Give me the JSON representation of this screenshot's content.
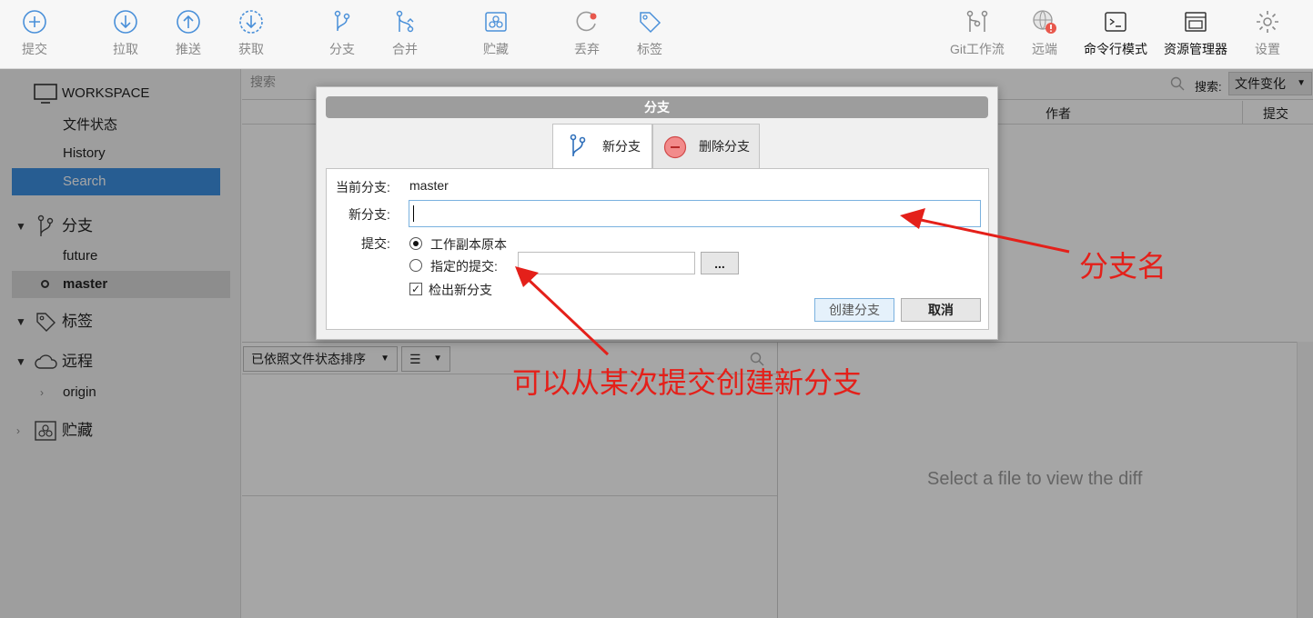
{
  "toolbar": {
    "commit": "提交",
    "pull": "拉取",
    "push": "推送",
    "fetch": "获取",
    "branch": "分支",
    "merge": "合并",
    "stash": "贮藏",
    "discard": "丢弃",
    "tag": "标签",
    "git_flow": "Git工作流",
    "remote": "远端",
    "terminal": "命令行模式",
    "explorer": "资源管理器",
    "settings": "设置"
  },
  "sidebar": {
    "workspace": "WORKSPACE",
    "file_status": "文件状态",
    "history": "History",
    "search": "Search",
    "branches": "分支",
    "branch_items": [
      "future",
      "master"
    ],
    "tags": "标签",
    "remotes": "远程",
    "remote_items": [
      "origin"
    ],
    "stashes": "贮藏"
  },
  "main": {
    "search_placeholder": "搜索",
    "search_label": "搜索:",
    "search_mode": "文件变化",
    "col_author": "作者",
    "col_commit": "提交",
    "sort_label": "已依照文件状态排序",
    "diff_placeholder": "Select a file to view the diff"
  },
  "dialog": {
    "title": "分支",
    "tab_new": "新分支",
    "tab_delete": "删除分支",
    "current_branch_label": "当前分支:",
    "current_branch_value": "master",
    "new_branch_label": "新分支:",
    "new_branch_value": "",
    "commit_label": "提交:",
    "option_working_copy": "工作副本原本",
    "option_specific": "指定的提交:",
    "browse": "...",
    "checkout_label": "检出新分支",
    "checkout_checked": true,
    "create_button": "创建分支",
    "cancel_button": "取消"
  },
  "annotations": {
    "branch_name": "分支名",
    "from_commit": "可以从某次提交创建新分支"
  },
  "colors": {
    "accent": "#3d8fe0",
    "annotation": "#e4201a"
  }
}
